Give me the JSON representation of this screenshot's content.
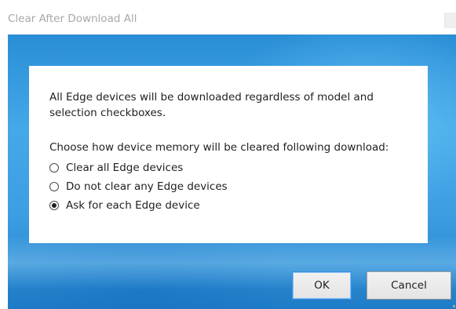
{
  "window": {
    "title": "Clear After Download All"
  },
  "dialog": {
    "message": "All Edge devices will be downloaded regardless of model and selection checkboxes.",
    "prompt": "Choose how device memory will be cleared following download:",
    "options": [
      {
        "label": "Clear all Edge devices",
        "selected": false
      },
      {
        "label": "Do not clear any Edge devices",
        "selected": false
      },
      {
        "label": "Ask for each Edge device",
        "selected": true
      }
    ]
  },
  "buttons": {
    "ok_label": "OK",
    "cancel_label": "Cancel"
  },
  "colors": {
    "dialog_background": "#2a8ed6",
    "primary_button_border": "#3c8ee0",
    "title_text": "#a8a8a8"
  }
}
